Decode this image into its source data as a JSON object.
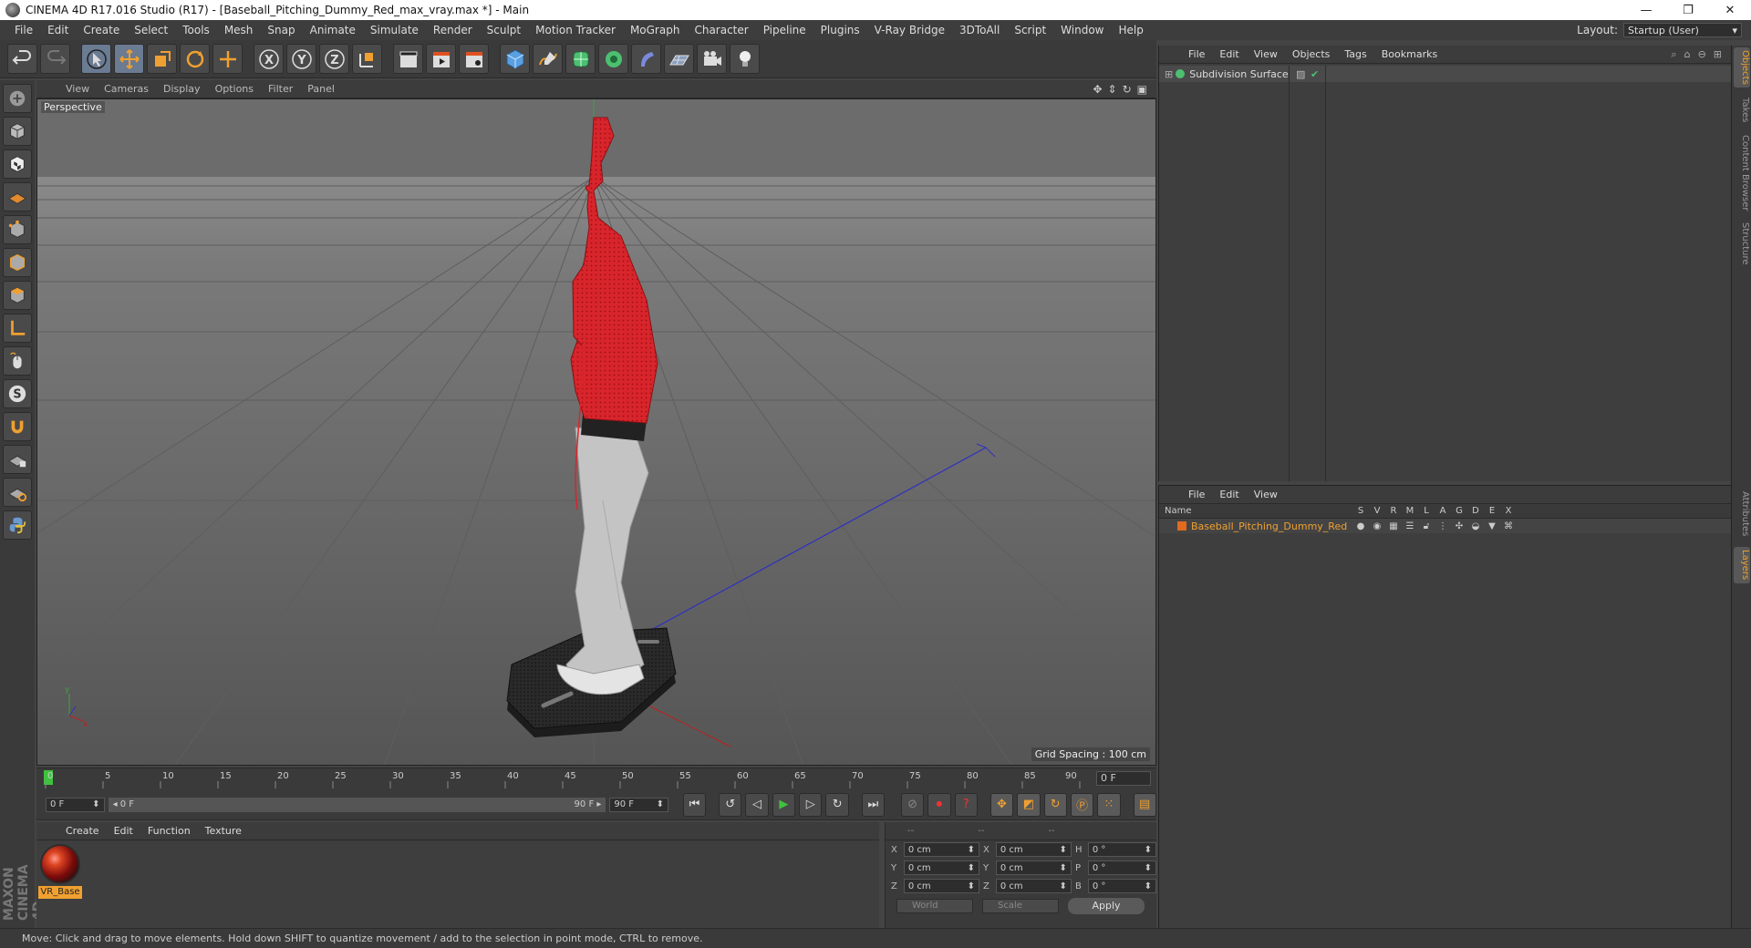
{
  "window": {
    "title": "CINEMA 4D R17.016 Studio (R17) - [Baseball_Pitching_Dummy_Red_max_vray.max *] - Main",
    "controls": [
      "—",
      "❐",
      "✕"
    ]
  },
  "menu": {
    "items": [
      "File",
      "Edit",
      "Create",
      "Select",
      "Tools",
      "Mesh",
      "Snap",
      "Animate",
      "Simulate",
      "Render",
      "Sculpt",
      "Motion Tracker",
      "MoGraph",
      "Character",
      "Pipeline",
      "Plugins",
      "V-Ray Bridge",
      "3DToAll",
      "Script",
      "Window",
      "Help"
    ],
    "layout_label": "Layout:",
    "layout_value": "Startup (User)"
  },
  "viewport": {
    "menu": [
      "View",
      "Cameras",
      "Display",
      "Options",
      "Filter",
      "Panel"
    ],
    "label": "Perspective",
    "grid_spacing": "Grid Spacing : 100 cm"
  },
  "timeline": {
    "ticks": [
      "0",
      "5",
      "10",
      "15",
      "20",
      "25",
      "30",
      "35",
      "40",
      "45",
      "50",
      "55",
      "60",
      "65",
      "70",
      "75",
      "80",
      "85",
      "90"
    ],
    "current_frame": "0 F"
  },
  "transport": {
    "start": "0 F",
    "range_start": "0 F",
    "range_end": "90 F",
    "end": "90 F"
  },
  "materials": {
    "menu": [
      "Create",
      "Edit",
      "Function",
      "Texture"
    ],
    "items": [
      {
        "name": "VR_Base"
      }
    ]
  },
  "coords": {
    "headers": [
      "--",
      "--",
      "--"
    ],
    "rows": [
      {
        "a": "X",
        "av": "0 cm",
        "b": "X",
        "bv": "0 cm",
        "c": "H",
        "cv": "0 °"
      },
      {
        "a": "Y",
        "av": "0 cm",
        "b": "Y",
        "bv": "0 cm",
        "c": "P",
        "cv": "0 °"
      },
      {
        "a": "Z",
        "av": "0 cm",
        "b": "Z",
        "bv": "0 cm",
        "c": "B",
        "cv": "0 °"
      }
    ],
    "space": "World",
    "mode": "Scale",
    "apply": "Apply"
  },
  "objects": {
    "menu": [
      "File",
      "Edit",
      "View",
      "Objects",
      "Tags",
      "Bookmarks"
    ],
    "items": [
      {
        "name": "Subdivision Surface"
      }
    ]
  },
  "layers": {
    "menu": [
      "File",
      "Edit",
      "View"
    ],
    "columns": [
      "Name",
      "S",
      "V",
      "R",
      "M",
      "L",
      "A",
      "G",
      "D",
      "E",
      "X"
    ],
    "items": [
      {
        "name": "Baseball_Pitching_Dummy_Red",
        "color": "#e06a20"
      }
    ]
  },
  "side_tabs": [
    "Objects",
    "Takes",
    "Content Browser",
    "Structure",
    "Attributes",
    "Layers"
  ],
  "status": "Move: Click and drag to move elements. Hold down SHIFT to quantize movement / add to the selection in point mode, CTRL to remove.",
  "colors": {
    "accent": "#f0a030",
    "dummy_red": "#d8252b",
    "pants_gray": "#c4c4c4",
    "base_black": "#262626"
  }
}
